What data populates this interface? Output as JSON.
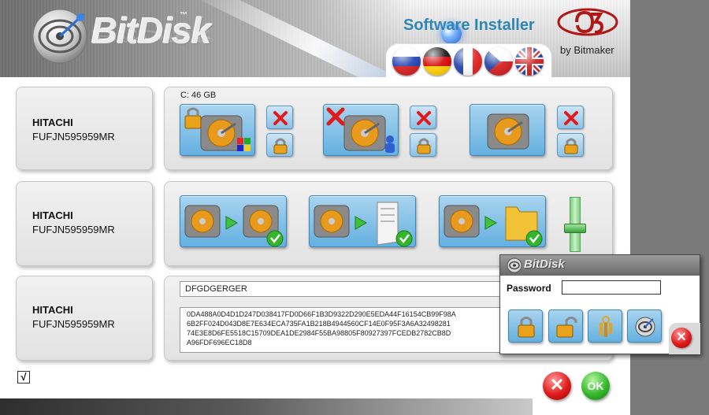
{
  "header": {
    "logo_text": "BitDisk",
    "logo_tm": "™",
    "title": "Software Installer",
    "brand_by": "by Bitmaker",
    "languages": [
      {
        "name": "russian-flag"
      },
      {
        "name": "german-flag"
      },
      {
        "name": "french-flag"
      },
      {
        "name": "czech-flag"
      },
      {
        "name": "uk-flag"
      }
    ]
  },
  "disks": [
    {
      "vendor": "HITACHI",
      "serial": "FUFJN595959MR"
    },
    {
      "vendor": "HITACHI",
      "serial": "FUFJN595959MR"
    },
    {
      "vendor": "HITACHI",
      "serial": "FUFJN595959MR"
    }
  ],
  "partition": {
    "label": "C:  46 GB",
    "icons": [
      "padlock-closed-icon",
      "delete-x-icon",
      "windows-logo-icon",
      "user-icon",
      "hard-drive-icon",
      "padlock-icon"
    ]
  },
  "actions": {
    "icons": [
      "drive-to-drive-icon",
      "drive-to-document-icon",
      "drive-to-folder-icon",
      "green-check-icon",
      "volume-slider"
    ],
    "slider_level": 0.5
  },
  "license": {
    "name_value": "DFGDGERGER",
    "key_text": "0DA488A0D4D1D247D038417FD0D66F1B3D9322D290E5EDA44F16154CB99F98A\n6B2FF024D043D8E7E634ECA735FA1B218B4944560CF14E0F95F3A6A32498281\n74E3E8D6FE5518C15709DEA1DE2984F55BA98805F80927397FCEDB2782CB8D\nA96FDF696EC18D8"
  },
  "footer": {
    "check_mark": "√",
    "cancel_symbol": "✕",
    "ok_label": "OK"
  },
  "password_dialog": {
    "logo_text": "BitDisk",
    "password_label": "Password",
    "password_value": "",
    "close_symbol": "✕",
    "buttons": [
      "unlock-icon",
      "lock-open-icon",
      "keys-icon",
      "bitdisk-settings-icon"
    ]
  },
  "colors": {
    "title_blue": "#2f86b5",
    "tile_blue": "#64b0e0",
    "delete_red": "#e01b1b",
    "ok_green": "#35b82c"
  }
}
